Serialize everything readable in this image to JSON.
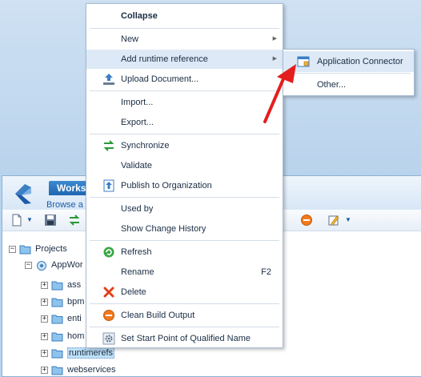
{
  "panel": {
    "title": "Works",
    "subtitle": "Browse a"
  },
  "tree": {
    "root": "Projects",
    "project": "AppWor",
    "items": [
      "ass",
      "bpm",
      "enti",
      "hom",
      "runtimerefs",
      "webservices"
    ]
  },
  "context_menu": {
    "collapse": "Collapse",
    "new": "New",
    "add_runtime_reference": "Add runtime reference",
    "upload_document": "Upload Document...",
    "import": "Import...",
    "export": "Export...",
    "synchronize": "Synchronize",
    "validate": "Validate",
    "publish": "Publish to Organization",
    "used_by": "Used by",
    "show_history": "Show Change History",
    "refresh": "Refresh",
    "rename": "Rename",
    "rename_shortcut": "F2",
    "delete": "Delete",
    "clean_build": "Clean Build Output",
    "set_start_point": "Set Start Point of Qualified Name"
  },
  "submenu": {
    "application_connector": "Application Connector",
    "other": "Other..."
  },
  "colors": {
    "accent": "#1f66b2",
    "highlight": "#dde9f6",
    "callout_arrow": "#e41e1e"
  }
}
